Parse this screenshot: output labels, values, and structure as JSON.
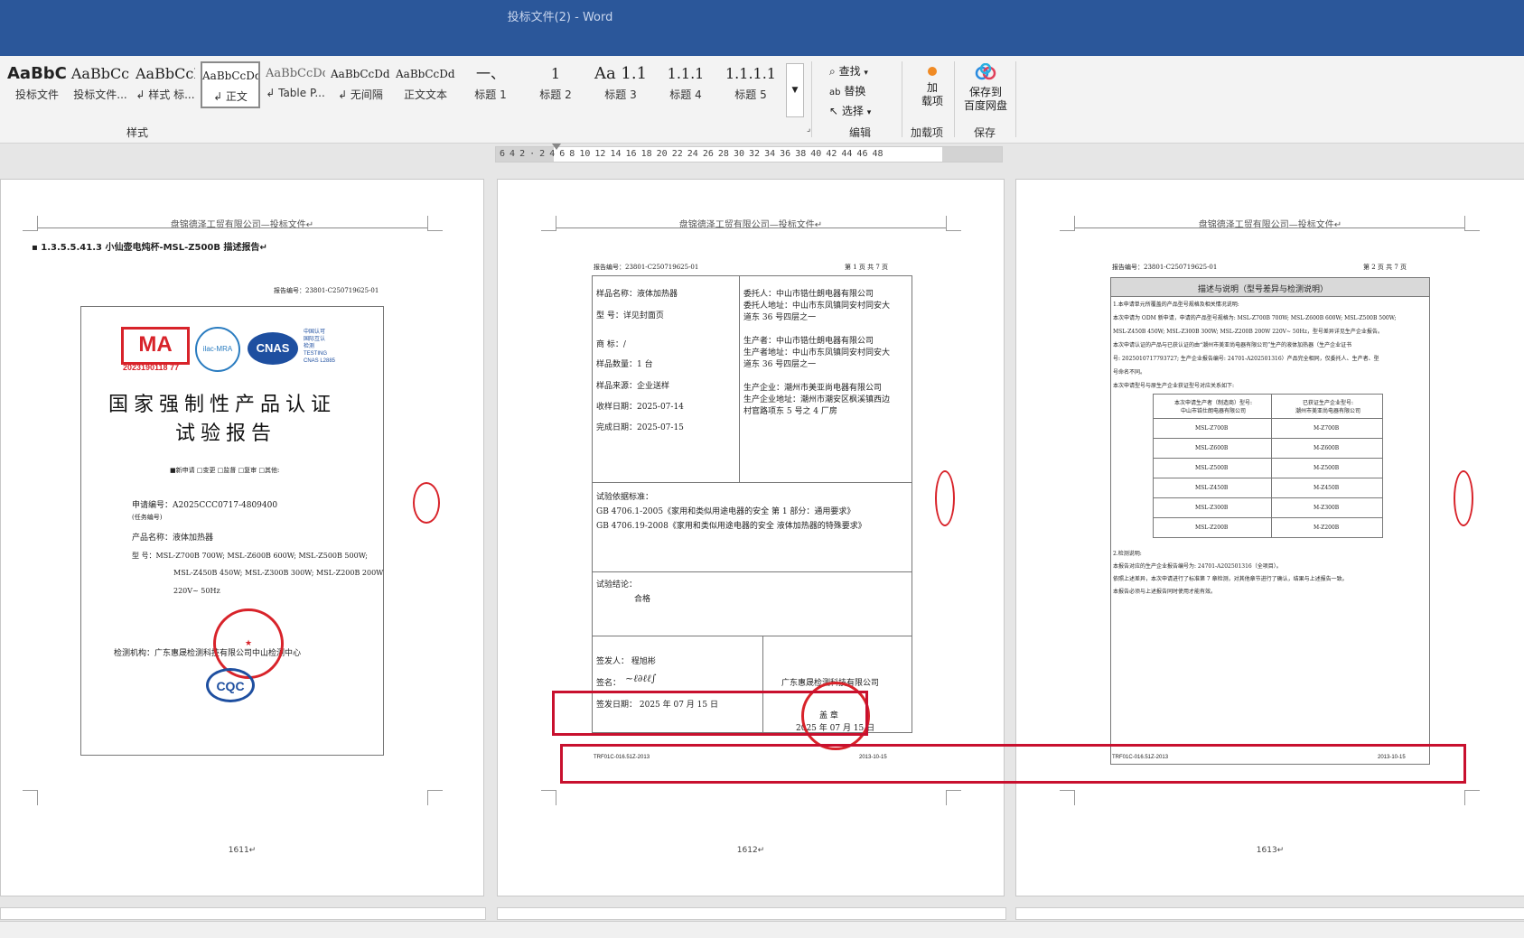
{
  "window": {
    "title": "投标文件(2)  -  Word"
  },
  "ribbon": {
    "styles": [
      {
        "preview": "AaBbC(",
        "name": "投标文件"
      },
      {
        "preview": "AaBbCc",
        "name": "投标文件..."
      },
      {
        "preview": "AaBbCcI",
        "name": "↲ 样式 标..."
      },
      {
        "preview": "AaBbCcDdI",
        "name": "↲ 正文"
      },
      {
        "preview": "AaBbCcDd",
        "name": "↲ Table P..."
      },
      {
        "preview": "AaBbCcDdI",
        "name": "↲ 无间隔"
      },
      {
        "preview": "AaBbCcDdI",
        "name": "正文文本"
      },
      {
        "preview": "一、",
        "name": "标题 1"
      },
      {
        "preview": "1",
        "name": "标题 2"
      },
      {
        "preview": "Aa 1.1",
        "name": "标题 3"
      },
      {
        "preview": "1.1.1",
        "name": "标题 4"
      },
      {
        "preview": "1.1.1.1",
        "name": "标题 5"
      }
    ],
    "styles_group": "样式",
    "edit": {
      "find": "查找",
      "replace": "替换",
      "select": "选择",
      "group": "编辑"
    },
    "addins": {
      "label": "加\n载项",
      "group": "加载项"
    },
    "save": {
      "label": "保存到\n百度网盘",
      "group": "保存"
    }
  },
  "ruler": {
    "ticks": "6  4  2  ·  2  4  6  8  10  12  14  16  18  20  22  24  26  28  30  32  34  36  38  40  42  44  46  48"
  },
  "pages": {
    "header": "盘锦德泽工贸有限公司—投标文件↵",
    "p1": {
      "heading": "▪ 1.3.5.5.41.3  小仙壶电炖杯-MSL-Z500B  描述报告↵",
      "report_no": "报告编号：23801-C250719625-01",
      "cma_no": "2023190118 77",
      "cert_title1": "国家强制性产品认证",
      "cert_title2": "试验报告",
      "checks": "■新申请  □变更  □监督  □复审  □其他:",
      "app_no": "申请编号：A2025CCC0717-4809400",
      "app_no_sub": "(任务编号)",
      "product": "产品名称：液体加热器",
      "model1": "型      号：MSL-Z700B 700W; MSL-Z600B 600W; MSL-Z500B 500W;",
      "model2": "MSL-Z450B 450W; MSL-Z300B 300W; MSL-Z200B 200W",
      "model3": "220V~  50Hz",
      "lab": "检测机构：广东惠晟检测科技有限公司中山检测中心",
      "page_no": "1611↵"
    },
    "p2": {
      "report_no": "报告编号：23801-C250719625-01",
      "page_of": "第 1 页 共 7 页",
      "left": [
        "样品名称：液体加热器",
        "型      号：详见封面页",
        "商      标：/",
        "样品数量：1 台",
        "样品来源：企业送样",
        "收样日期：2025-07-14",
        "完成日期：2025-07-15"
      ],
      "right": [
        "委托人：中山市锆仕朗电器有限公司",
        "委托人地址：中山市东凤镇同安村同安大",
        "道东 36 号四层之一",
        "生产者：中山市锆仕朗电器有限公司",
        "生产者地址：中山市东凤镇同安村同安大",
        "道东 36 号四层之一",
        "生产企业：潮州市美亚尚电器有限公司",
        "生产企业地址：潮州市潮安区枫溪镇西边",
        "村官路项东 5 号之 4 厂房"
      ],
      "std_title": "试验依据标准：",
      "std1": "GB 4706.1-2005《家用和类似用途电器的安全 第 1 部分：通用要求》",
      "std2": "GB 4706.19-2008《家用和类似用途电器的安全 液体加热器的特殊要求》",
      "conclusion_title": "试验结论：",
      "conclusion": "合格",
      "signer": "签发人：  程旭彬",
      "sign": "签名：",
      "sign_date": "签发日期： 2025 年 07 月 15 日",
      "company": "广东惠晟检测科技有限公司",
      "seal": "盖    章",
      "seal_date": "2025 年 07 月 15 日",
      "footer_code": "TRF01C-016.51Z-2013",
      "footer_date": "2013-10-15",
      "page_no": "1612↵"
    },
    "p3": {
      "report_no": "报告编号：23801-C250719625-01",
      "page_of": "第 2 页 共 7 页",
      "desc_title": "描述与说明（型号差异与检测说明）",
      "desc_lines": [
        "1.本申请单元所覆盖的产品型号规格及相关情况说明:",
        "    本次申请为 ODM 新申请，申请的产品型号规格为: MSL-Z700B 700W; MSL-Z600B 600W; MSL-Z500B 500W;",
        "MSL-Z450B 450W; MSL-Z300B 300W; MSL-Z200B 200W 220V~ 50Hz，型号差异详见生产企业报告。",
        "    本次申请认证的产品与已获认证的由“潮州市美亚尚电器有限公司”生产的液体加热器（生产企业证书",
        "号: 2025010717793727; 生产企业报告编号: 24701-A202501316）产品完全相同，仅委托人、生产者、型",
        "号命名不同。",
        "    本次申请型号与原生产企业获证型号对应关系如下:"
      ],
      "tbl_head_l": "本次申请生产者（制造商）型号:\n中山市锆仕朗电器有限公司",
      "tbl_head_r": "已获证生产企业型号:\n潮州市美亚尚电器有限公司",
      "rows": [
        [
          "MSL-Z700B",
          "M-Z700B"
        ],
        [
          "MSL-Z600B",
          "M-Z600B"
        ],
        [
          "MSL-Z500B",
          "M-Z500B"
        ],
        [
          "MSL-Z450B",
          "M-Z450B"
        ],
        [
          "MSL-Z300B",
          "M-Z300B"
        ],
        [
          "MSL-Z200B",
          "M-Z200B"
        ]
      ],
      "test_lines": [
        "2.检测说明:",
        "    本报告对应的生产企业报告编号为: 24701-A202501316（全项目）。",
        "    依照上述差异，本次申请进行了标准第 7 章检测，对其他章节进行了确认，结果与上述报告一致。",
        "    本报告必须与上述报告同时使用才能有效。"
      ],
      "footer_code": "TRF01C-016.51Z-2013",
      "footer_date": "2013-10-15",
      "page_no": "1613↵"
    }
  },
  "colors": {
    "titlebar": "#2b579a",
    "highlight_box": "#c8102e",
    "stamp": "#d8232a"
  }
}
